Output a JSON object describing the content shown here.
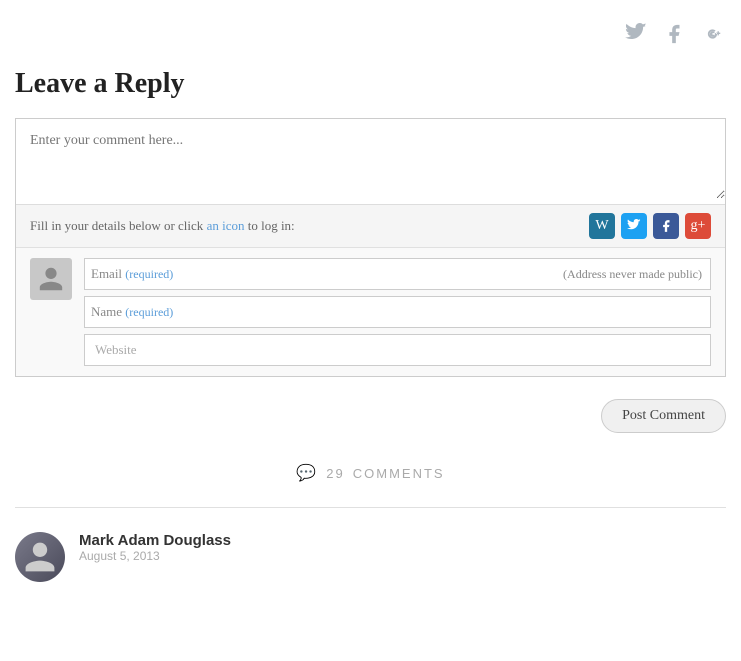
{
  "top_social": {
    "twitter_label": "Twitter",
    "facebook_label": "Facebook",
    "googleplus_label": "Google+"
  },
  "heading": {
    "title": "Leave a Reply"
  },
  "comment_form": {
    "textarea_placeholder": "Enter your comment here...",
    "fill_details_text_before": "Fill in your details below or click ",
    "fill_details_link": "an icon",
    "fill_details_text_after": " to log in:",
    "email_label": "Email",
    "email_required": "(required)",
    "email_note": "(Address never made public)",
    "name_placeholder": "Name",
    "name_required": "(required)",
    "website_placeholder": "Website",
    "post_comment_label": "Post Comment"
  },
  "comments_section": {
    "count": "29",
    "label": "COMMENTS"
  },
  "first_comment": {
    "author": "Mark Adam Douglass",
    "date": "August 5, 2013"
  }
}
